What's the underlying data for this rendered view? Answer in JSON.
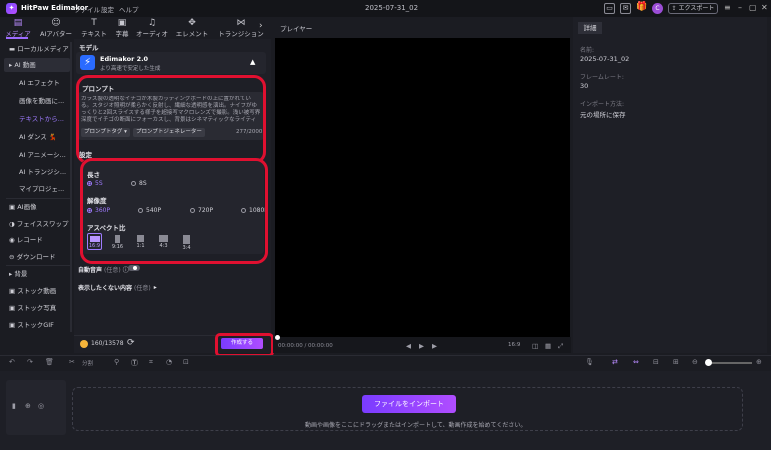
{
  "titlebar": {
    "app_name": "HitPaw Edimakor",
    "menu": [
      "ファイル",
      "設定",
      "ヘルプ"
    ],
    "project_title": "2025-07-31_02",
    "avatar_letter": "C",
    "export_label": "エクスポート"
  },
  "toolbar": {
    "tabs": [
      {
        "label": "メディア",
        "icon": "media-icon"
      },
      {
        "label": "AIアバター",
        "icon": "avatar-icon"
      },
      {
        "label": "テキスト",
        "icon": "text-icon"
      },
      {
        "label": "字幕",
        "icon": "subtitle-icon"
      },
      {
        "label": "オーディオ",
        "icon": "audio-icon"
      },
      {
        "label": "エレメント",
        "icon": "element-icon"
      },
      {
        "label": "トランジション",
        "icon": "transition-icon"
      }
    ],
    "active_index": 0
  },
  "sidebar": {
    "items": [
      {
        "label": "ローカルメディア",
        "level": 0
      },
      {
        "label": "AI 動画",
        "level": 0,
        "expanded": true
      },
      {
        "label": "AI エフェクト",
        "level": 1
      },
      {
        "label": "画像を動画に...",
        "level": 1
      },
      {
        "label": "テキストから...",
        "level": 1,
        "current": true
      },
      {
        "label": "AI ダンス 💃",
        "level": 1
      },
      {
        "label": "AI アニメーシ...",
        "level": 1
      },
      {
        "label": "AI トランジシ...",
        "level": 1
      },
      {
        "label": "マイプロジェ...",
        "level": 1
      },
      {
        "label": "AI画像",
        "level": 0
      },
      {
        "label": "フェイススワップ",
        "level": 0
      },
      {
        "label": "レコード",
        "level": 0
      },
      {
        "label": "ダウンロード",
        "level": 0
      },
      {
        "label": "背景",
        "level": 0
      },
      {
        "label": "ストック動画",
        "level": 0
      },
      {
        "label": "ストック写真",
        "level": 0
      },
      {
        "label": "ストックGIF",
        "level": 0
      }
    ]
  },
  "panel": {
    "model_label": "モデル",
    "model_name": "Edimakor 2.0",
    "model_desc": "より高速で安定した生成",
    "prompt_label": "プロンプト",
    "prompt_text": "ガラス製の透明なイチゴが木製カッティングボードの上に置かれている。スタジオ照明が柔らかく反射し、繊細な透明感を演出。ナイフがゆっくりと2回スライスする様子を超接写マクロレンズで撮影。浅い被写界深度でイチゴの断面にフォーカスし、背景はシネマティックなライティ",
    "prompt_tag_btn": "プロンプトタグ ▾",
    "prompt_gen_btn": "プロンプトジェネレーター",
    "prompt_count": "277/2000",
    "settings_label": "設定",
    "length_label": "長さ",
    "length_options": [
      "5S",
      "8S"
    ],
    "length_selected": "5S",
    "resolution_label": "解像度",
    "resolution_options": [
      "360P",
      "540P",
      "720P",
      "1080P"
    ],
    "resolution_selected": "360P",
    "aspect_label": "アスペクト比",
    "aspect_options": [
      "16:9",
      "9:16",
      "1:1",
      "4:3",
      "3:4"
    ],
    "aspect_selected": "16:9",
    "auto_audio_label": "自動音声",
    "auto_audio_note": "(任意)",
    "auto_audio_on": false,
    "negative_label": "表示したくない内容",
    "negative_note": "(任意)",
    "credits": "160/13578",
    "create_btn": "作成する"
  },
  "player": {
    "label": "プレイヤー",
    "timecode": "00:00:00 / 00:00:00",
    "speed": "16:9"
  },
  "details": {
    "tab": "詳細",
    "fields": [
      {
        "key": "名前:",
        "value": "2025-07-31_02"
      },
      {
        "key": "フレームレート:",
        "value": "30"
      },
      {
        "key": "インポート方法:",
        "value": "元の場所に保存"
      }
    ]
  },
  "timeline": {
    "split_label": "分割",
    "import_btn": "ファイルをインポート",
    "drop_hint": "動画や画像をここにドラッグまたはインポートして、動画作成を始めてください。"
  },
  "colors": {
    "accent": "#9d6bff",
    "highlight_outline": "#e01030",
    "create_button": "#7a3cff"
  }
}
